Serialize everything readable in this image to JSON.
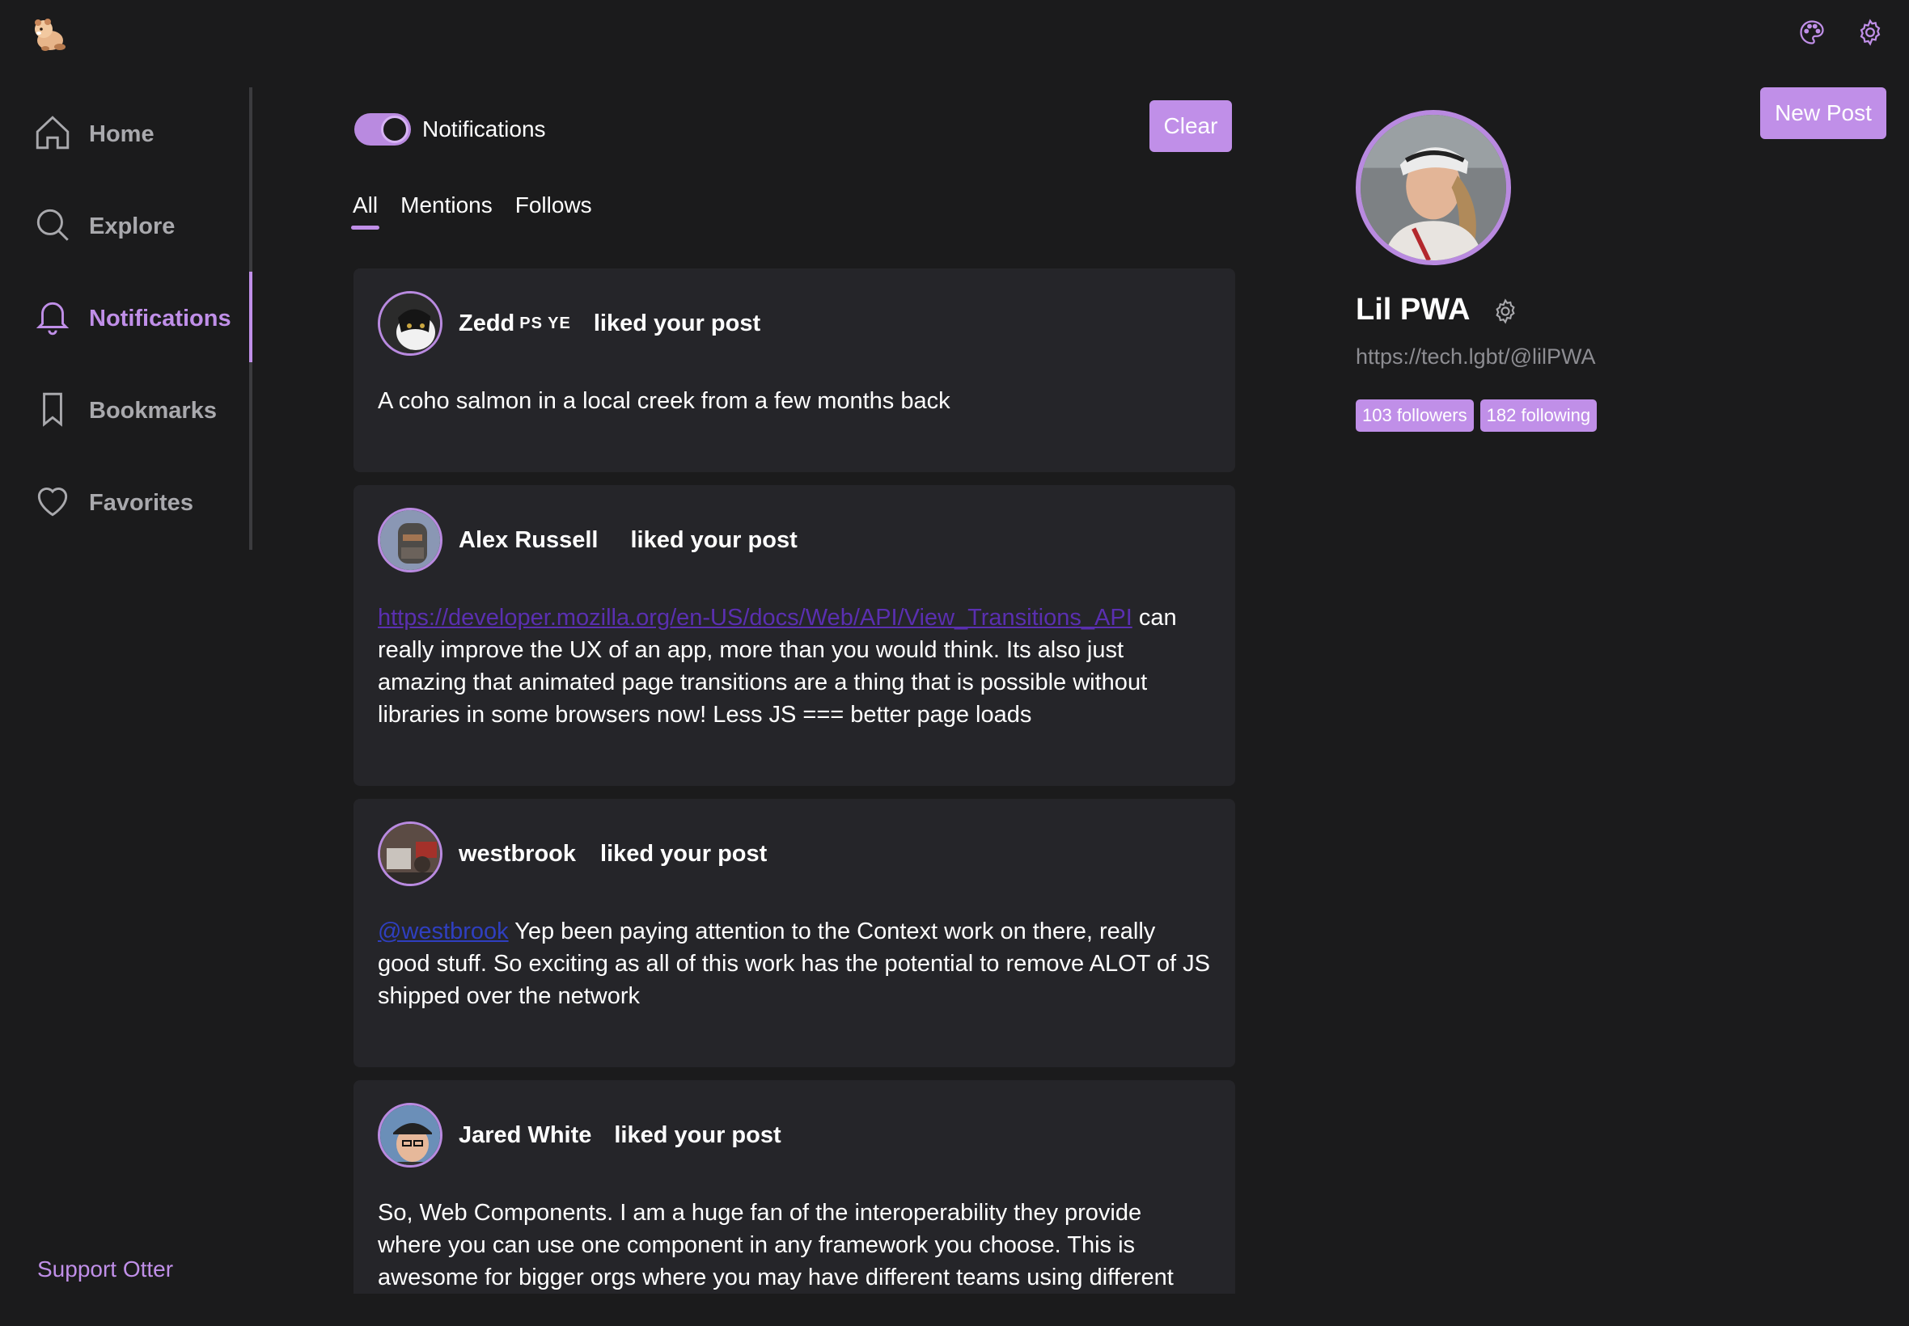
{
  "app": {
    "logo_icon": "otter-logo",
    "accent": "#c08fe8"
  },
  "topbar": {
    "icons": [
      "palette-icon",
      "settings-icon"
    ]
  },
  "sidebar": {
    "items": [
      {
        "label": "Home",
        "icon": "home-icon"
      },
      {
        "label": "Explore",
        "icon": "search-icon"
      },
      {
        "label": "Notifications",
        "icon": "bell-icon",
        "active": true
      },
      {
        "label": "Bookmarks",
        "icon": "bookmark-icon"
      },
      {
        "label": "Favorites",
        "icon": "heart-icon"
      }
    ],
    "support_label": "Support Otter"
  },
  "notifications": {
    "toggle_label": "Notifications",
    "toggle_on": true,
    "clear_label": "Clear",
    "tabs": [
      {
        "label": "All",
        "active": true
      },
      {
        "label": "Mentions"
      },
      {
        "label": "Follows"
      }
    ],
    "items": [
      {
        "author": "Zedd",
        "author_extra": "PS YE",
        "action": "liked your post",
        "body_link": "",
        "body": "A coho salmon in a local creek from a few months back"
      },
      {
        "author": "Alex Russell",
        "author_extra": "",
        "action": "liked your post",
        "body_link": "https://developer.mozilla.org/en-US/docs/Web/API/View_Transitions_API",
        "body": " can really improve the UX of an app, more than you would think. Its also just amazing that animated page transitions are a thing that is possible without libraries in some browsers now! Less JS === better page loads"
      },
      {
        "author": "westbrook",
        "author_extra": "",
        "action": "liked your post",
        "body_mention": "@westbrook",
        "body": " Yep been paying attention to the Context work on there, really good stuff. So exciting as all of this work has the potential to remove ALOT of JS shipped over the network"
      },
      {
        "author": "Jared White",
        "author_extra": "",
        "action": "liked your post",
        "body_link": "",
        "body": "So, Web Components. I am a huge fan of the interoperability they provide where you can use one component in any framework you choose. This is awesome for bigger orgs where you may have different teams using different web frameworks"
      }
    ]
  },
  "profile": {
    "new_post_label": "New Post",
    "name": "Lil PWA",
    "url": "https://tech.lgbt/@lilPWA",
    "followers": "103 followers",
    "following": "182 following"
  }
}
